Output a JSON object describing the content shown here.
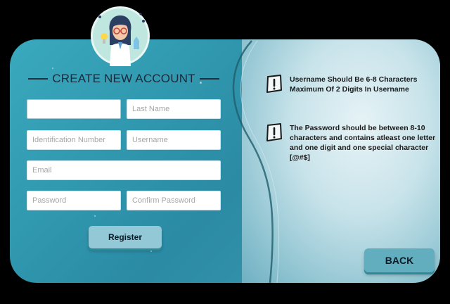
{
  "form": {
    "title": "CREATE NEW ACCOUNT",
    "fields": {
      "first_name": {
        "value": "",
        "placeholder": ""
      },
      "last_name": {
        "value": "",
        "placeholder": "Last Name"
      },
      "identification": {
        "value": "",
        "placeholder": "Identification Number"
      },
      "username": {
        "value": "",
        "placeholder": "Username"
      },
      "email": {
        "value": "",
        "placeholder": "Email"
      },
      "password": {
        "value": "",
        "placeholder": "Password"
      },
      "confirm_password": {
        "value": "",
        "placeholder": "Confirm Password"
      }
    },
    "register_label": "Register"
  },
  "notes": {
    "username_rule": "Username Should Be 6-8 Characters Maximum Of 2 Digits In Username",
    "password_rule": "The Password should be between 8-10 characters and contains atleast one letter and one digit and one special character [@#$]"
  },
  "back_label": "BACK",
  "icons": {
    "avatar": "scientist-avatar-icon",
    "warning": "exclamation-icon"
  },
  "colors": {
    "panel_teal": "#2f96ad",
    "button_light": "#93c8d6",
    "button_back": "#62aebf",
    "title_text": "#1b2a3c"
  }
}
